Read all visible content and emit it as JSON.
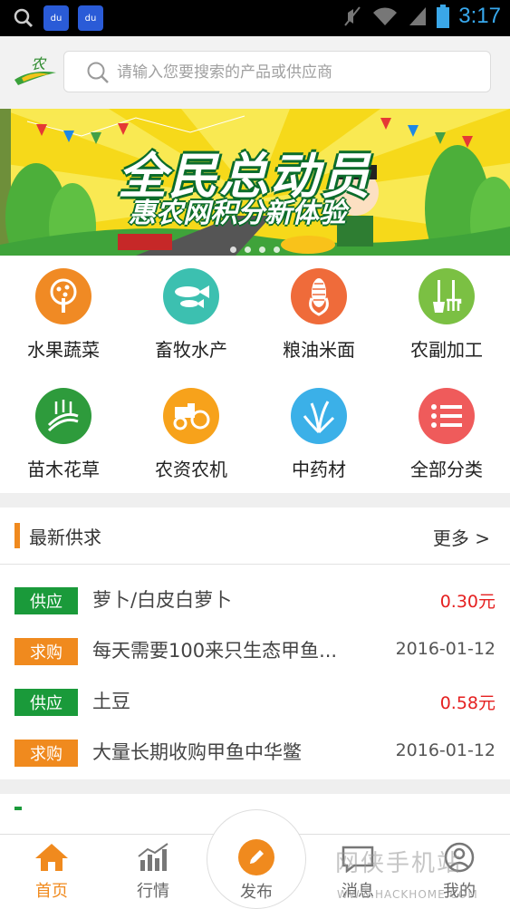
{
  "status_bar": {
    "time": "3:17",
    "baidu_label": "du"
  },
  "search": {
    "placeholder": "请输入您要搜索的产品或供应商"
  },
  "banner": {
    "title": "全民总动员",
    "subtitle": "惠农网积分新体验"
  },
  "categories": [
    {
      "label": "水果蔬菜",
      "icon": "fruit-tree-icon",
      "color": "#f08a24"
    },
    {
      "label": "畜牧水产",
      "icon": "fish-icon",
      "color": "#3cc0b0"
    },
    {
      "label": "粮油米面",
      "icon": "corn-icon",
      "color": "#ef6b3a"
    },
    {
      "label": "农副加工",
      "icon": "tools-icon",
      "color": "#7bc043"
    },
    {
      "label": "苗木花草",
      "icon": "field-icon",
      "color": "#2e9b3c"
    },
    {
      "label": "农资农机",
      "icon": "tractor-icon",
      "color": "#f7a21b"
    },
    {
      "label": "中药材",
      "icon": "herb-icon",
      "color": "#3bb0e8"
    },
    {
      "label": "全部分类",
      "icon": "list-icon",
      "color": "#ef5b5b"
    }
  ],
  "news": {
    "title": "最新供求",
    "more": "更多 >",
    "items": [
      {
        "tag": "供应",
        "type": "supply",
        "name": "萝卜/白皮白萝卜",
        "value": "0.30元"
      },
      {
        "tag": "求购",
        "type": "buy",
        "name": "每天需要100来只生态甲鱼...",
        "value": "2016-01-12"
      },
      {
        "tag": "供应",
        "type": "supply",
        "name": "土豆",
        "value": "0.58元"
      },
      {
        "tag": "求购",
        "type": "buy",
        "name": "大量长期收购甲鱼中华鳖",
        "value": "2016-01-12"
      }
    ]
  },
  "nav": {
    "home": "首页",
    "market": "行情",
    "publish": "发布",
    "messages": "消息",
    "mine": "我的"
  },
  "watermark": {
    "text": "网侠手机站",
    "url": "WWW.HACKHOME.COM"
  }
}
